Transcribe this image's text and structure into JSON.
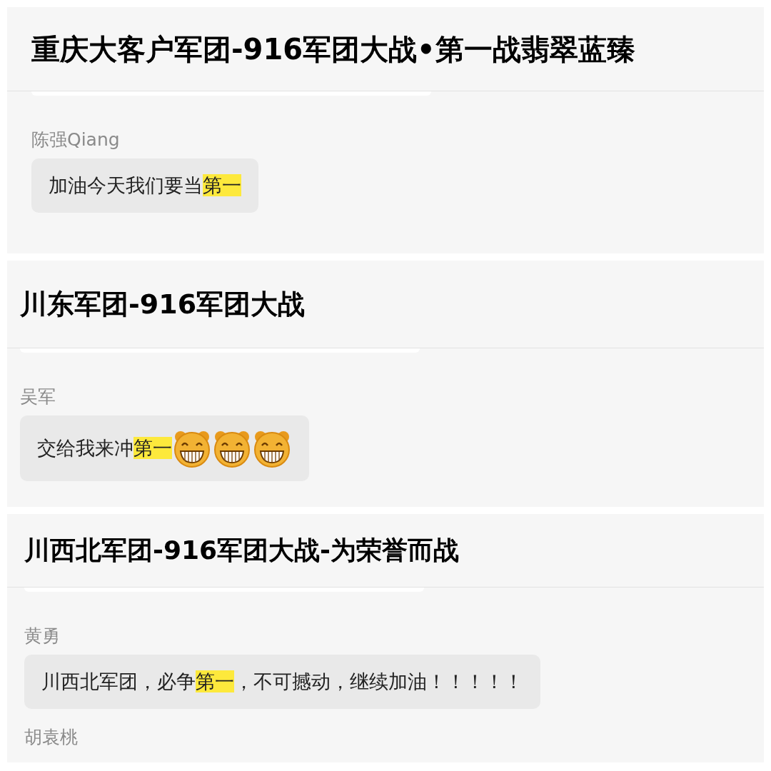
{
  "panels": [
    {
      "title": "重庆大客户军团-916军团大战•第一战翡翠蓝臻",
      "messages": [
        {
          "sender": "陈强Qiang",
          "segments": [
            {
              "text": "加油今天我们要当",
              "highlighted": false
            },
            {
              "text": "第一",
              "highlighted": true
            }
          ]
        }
      ]
    },
    {
      "title": "川东军团-916军团大战",
      "messages": [
        {
          "sender": "吴军",
          "segments": [
            {
              "text": "交给我来冲",
              "highlighted": false
            },
            {
              "text": "第一",
              "highlighted": true
            }
          ],
          "emojis": [
            {
              "kind": "grin"
            },
            {
              "kind": "grin"
            },
            {
              "kind": "grin"
            }
          ]
        }
      ]
    },
    {
      "title": "川西北军团-916军团大战-为荣誉而战",
      "messages": [
        {
          "sender": "黄勇",
          "segments": [
            {
              "text": "川西北军团，必争",
              "highlighted": false
            },
            {
              "text": "第一",
              "highlighted": true
            },
            {
              "text": "，不可撼动，继续加油！！！！！",
              "highlighted": false
            }
          ]
        },
        {
          "sender": "胡袁桃"
        }
      ]
    }
  ]
}
